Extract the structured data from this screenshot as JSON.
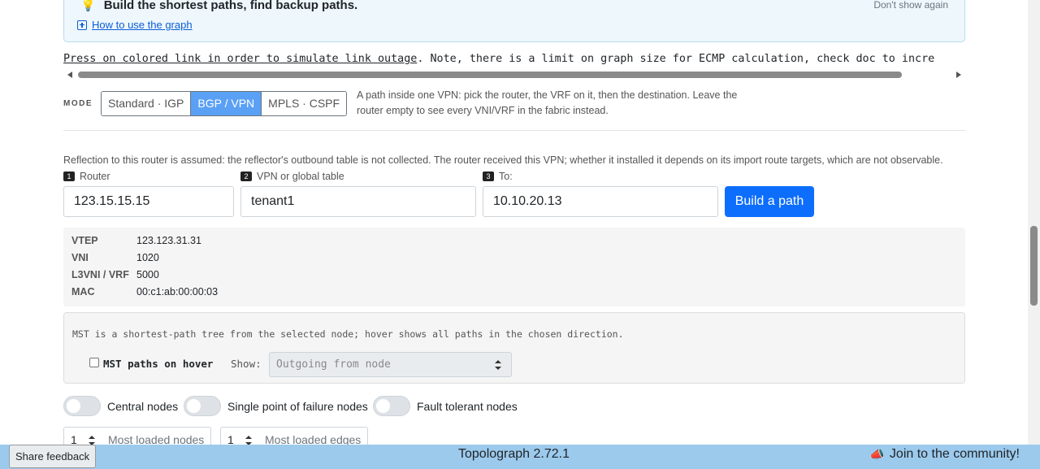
{
  "tip": {
    "title": "Build the shortest paths, find backup paths.",
    "dont_show": "Don't show again",
    "howto": "How to use the graph"
  },
  "notice": {
    "link": "Press on colored link in order to simulate link outage",
    "rest": ". Note, there is a limit on graph size for ECMP calculation, check doc to incre"
  },
  "mode": {
    "label": "MODE",
    "options": [
      "Standard · IGP",
      "BGP / VPN",
      "MPLS · CSPF"
    ],
    "active": "BGP / VPN",
    "help": "A path inside one VPN: pick the router, the VRF on it, then the destination. Leave the router empty to see every VNI/VRF in the fabric instead."
  },
  "reflection": "Reflection to this router is assumed: the reflector's outbound table is not collected. The router received this VPN; whether it installed it depends on its import route targets, which are not observable.",
  "form": {
    "router": {
      "num": "1",
      "label": "Router",
      "value": "123.15.15.15"
    },
    "vpn": {
      "num": "2",
      "label": "VPN or global table",
      "value": "tenant1"
    },
    "to": {
      "num": "3",
      "label": "To:",
      "value": "10.10.20.13"
    },
    "build_label": "Build a path"
  },
  "info": {
    "rows": [
      {
        "key": "VTEP",
        "value": "123.123.31.31"
      },
      {
        "key": "VNI",
        "value": "1020"
      },
      {
        "key": "L3VNI / VRF",
        "value": "5000"
      },
      {
        "key": "MAC",
        "value": "00:c1:ab:00:00:03"
      }
    ]
  },
  "mst": {
    "desc": "MST is a shortest-path tree from the selected node; hover shows all paths in the chosen direction.",
    "checkbox_label": "MST paths on hover",
    "show_label": "Show:",
    "show_value": "Outgoing from node"
  },
  "toggles": {
    "central": "Central nodes",
    "spof": "Single point of failure nodes",
    "fault": "Fault tolerant nodes"
  },
  "loaded": {
    "nodes_value": "1",
    "nodes_label": "Most loaded nodes",
    "edges_value": "1",
    "edges_label": "Most loaded edges"
  },
  "footer": {
    "title": "Topolograph 2.72.1",
    "feedback": "Share feedback",
    "community": "Join to the community!"
  }
}
